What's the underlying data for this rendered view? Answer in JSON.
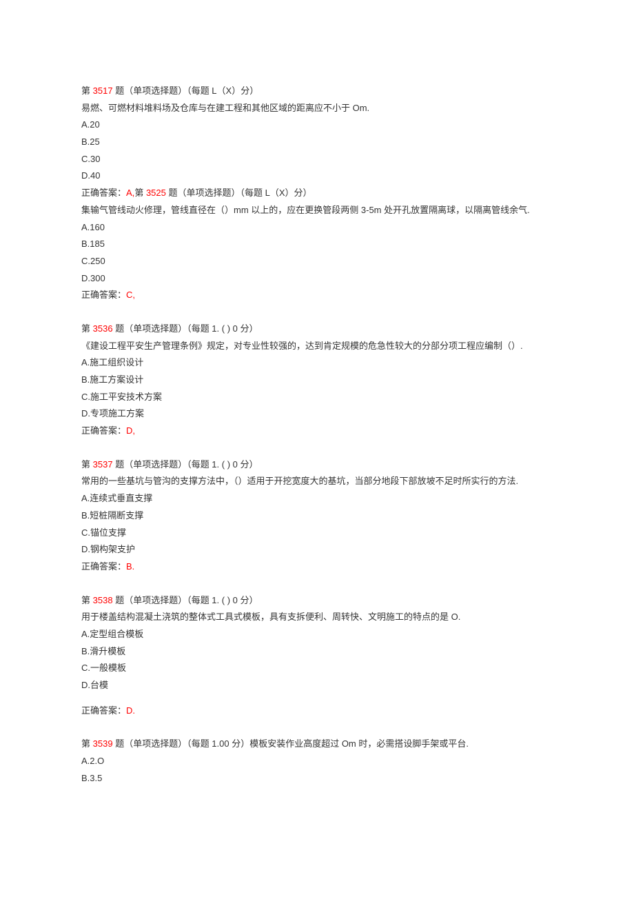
{
  "questions": [
    {
      "id": "q3517",
      "prefix": "第",
      "number": "3517",
      "header_suffix": "题（单项选择题）（每题 L（X）分）",
      "stem": "易燃、可燃材料堆料场及仓库与在建工程和其他区域的距离应不小于 Om.",
      "options": [
        "A.20",
        "B.25",
        "C.30",
        "D.40"
      ],
      "answer_label": "正确答案：",
      "answer_value": "A,",
      "next_inline_prefix": "第",
      "next_inline_number": "3525",
      "next_inline_suffix": "题（单项选择题）（每题 L（X）分）"
    },
    {
      "id": "q3525",
      "stem": "集输气管线动火修理，管线直径在（）mm 以上的，应在更换管段两侧 3-5m 处开孔放置隔离球，以隔离管线余气.",
      "options": [
        "A.160",
        "B.185",
        "C.250",
        "D.300"
      ],
      "answer_label": "正确答案：",
      "answer_value": "C,"
    },
    {
      "id": "q3536",
      "prefix": "第",
      "number": "3536",
      "header_suffix": "题（单项选择题）（每题 1. ( ) 0 分）",
      "stem": "《建设工程平安生产管理条例》规定，对专业性较强的，达到肯定规模的危急性较大的分部分项工程应编制（）.",
      "options": [
        "A.施工组织设计",
        "B.施工方案设计",
        "C.施工平安技术方案",
        "D.专项施工方案"
      ],
      "answer_label": "正确答案：",
      "answer_value": "D,"
    },
    {
      "id": "q3537",
      "prefix": "第",
      "number": "3537",
      "header_suffix": "题（单项选择题）（每题 1. ( ) 0 分）",
      "stem": "常用的一些基坑与管沟的支撑方法中，（）适用于开挖宽度大的基坑，当部分地段下部放坡不足时所实行的方法.",
      "options": [
        "A.连续式垂直支撑",
        "B.短桩隔断支撑",
        "C.锚位支撑",
        "D.钢构架支护"
      ],
      "answer_label": "正确答案：",
      "answer_value": "B."
    },
    {
      "id": "q3538",
      "prefix": "第",
      "number": "3538",
      "header_suffix": "题（单项选择题）（每题 1. ( ) 0 分）",
      "stem": "用于楼盖结构混凝土浇筑的整体式工具式模板，具有支拆便利、周转快、文明施工的特点的是 O.",
      "options": [
        "A.定型组合模板",
        "B.滑升模板",
        "C.一般模板",
        "D.台模"
      ],
      "answer_label": "正确答案：",
      "answer_value": "D."
    },
    {
      "id": "q3539",
      "prefix": "第",
      "number": "3539",
      "header_suffix": "题（单项选择题）（每题 1.00 分）模板安装作业高度超过 Om 时，必需搭设脚手架或平台.",
      "options": [
        "A.2.O",
        "B.3.5"
      ]
    }
  ]
}
